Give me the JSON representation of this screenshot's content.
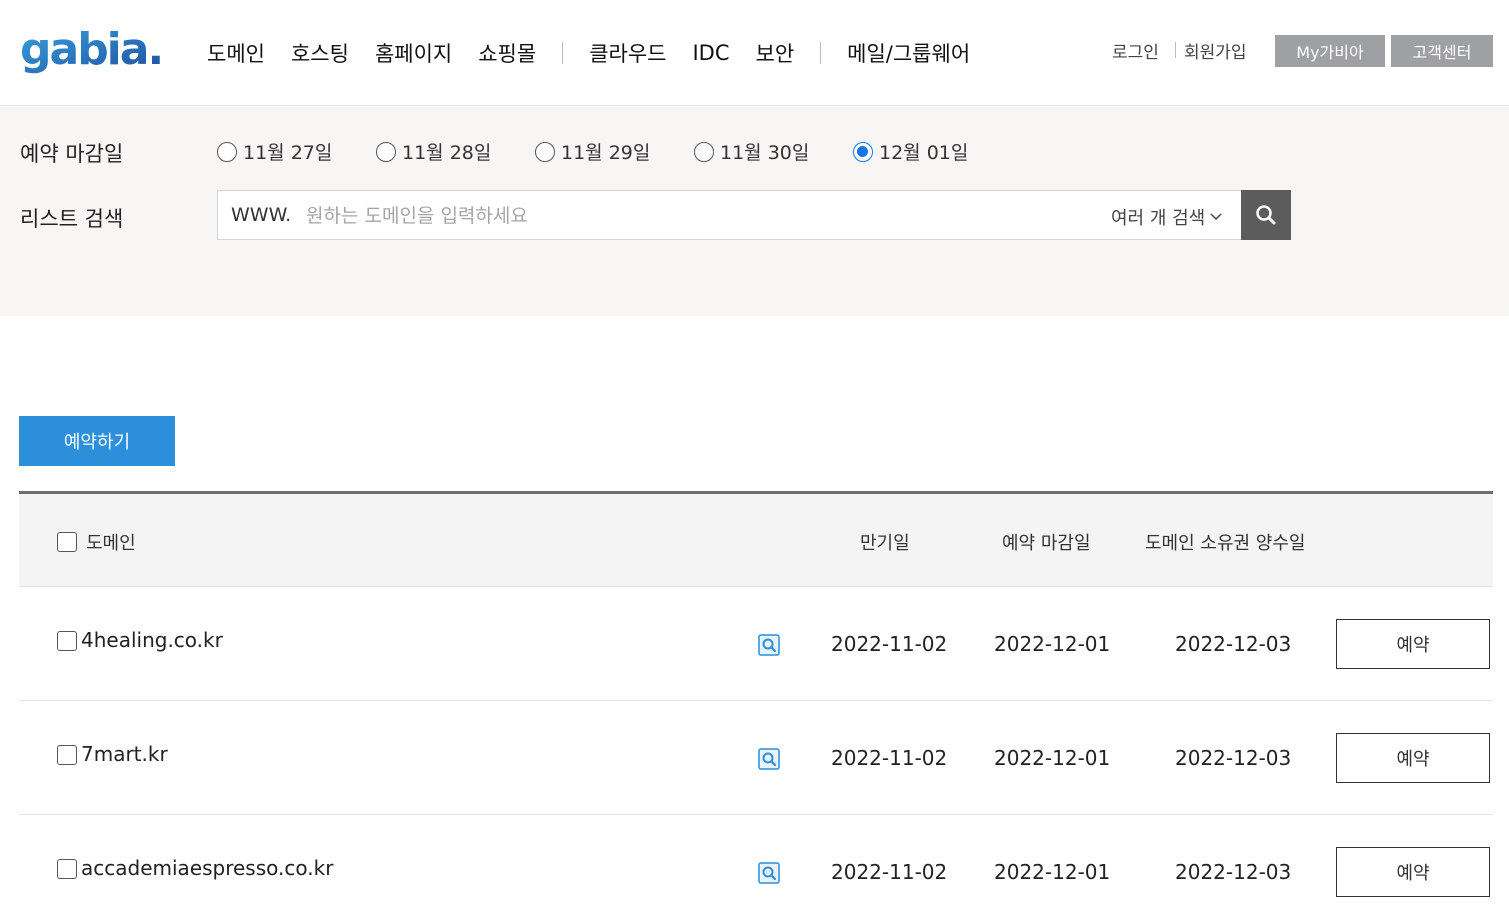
{
  "header": {
    "logo_text": "gabia.",
    "nav": [
      "도메인",
      "호스팅",
      "홈페이지",
      "쇼핑몰",
      "클라우드",
      "IDC",
      "보안",
      "메일/그룹웨어"
    ],
    "login": "로그인",
    "signup": "회원가입",
    "my_gabia": "My가비아",
    "customer_center": "고객센터"
  },
  "filter": {
    "deadline_label": "예약 마감일",
    "dates": [
      "11월 27일",
      "11월 28일",
      "11월 29일",
      "11월 30일",
      "12월 01일"
    ],
    "selected_date": "12월 01일",
    "search_label": "리스트 검색",
    "www_prefix": "WWW.",
    "search_placeholder": "원하는 도메인을 입력하세요",
    "multi_search": "여러 개 검색"
  },
  "reserve_button": "예약하기",
  "table": {
    "headers": {
      "domain": "도메인",
      "expire": "만기일",
      "deadline": "예약 마감일",
      "transfer": "도메인 소유권 양수일"
    },
    "rows": [
      {
        "domain": "4healing.co.kr",
        "expire": "2022-11-02",
        "deadline": "2022-12-01",
        "transfer": "2022-12-03",
        "action": "예약"
      },
      {
        "domain": "7mart.kr",
        "expire": "2022-11-02",
        "deadline": "2022-12-01",
        "transfer": "2022-12-03",
        "action": "예약"
      },
      {
        "domain": "accademiaespresso.co.kr",
        "expire": "2022-11-02",
        "deadline": "2022-12-01",
        "transfer": "2022-12-03",
        "action": "예약"
      }
    ]
  },
  "colors": {
    "accent": "#2b8fdc",
    "radio_checked": "#1a73e8",
    "top_button": "#9ea0a3",
    "search_button": "#5c5c5c",
    "filter_bg": "#f8f6f4"
  }
}
